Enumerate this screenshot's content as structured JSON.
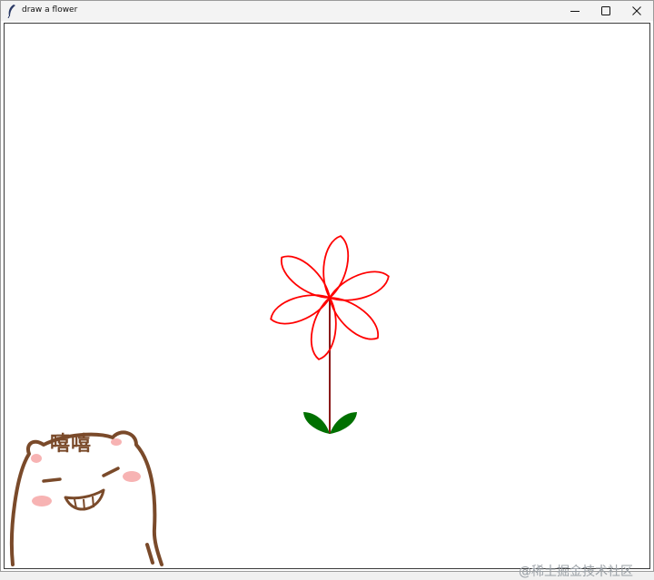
{
  "window": {
    "title": "draw a flower",
    "icon": "feather-icon",
    "controls": {
      "minimize": "minimize-icon",
      "maximize": "maximize-icon",
      "close": "close-icon"
    }
  },
  "canvas": {
    "background": "#ffffff",
    "flower": {
      "petal_color": "#ff0000",
      "stem_color": "#8b1a1a",
      "leaf_color": "#007000",
      "petal_count": 6
    }
  },
  "overlay": {
    "sticker_caption": "嘻嘻",
    "watermark": "@稀土掘金技术社区"
  },
  "colors": {
    "sticker_outline": "#7a4a2a",
    "sticker_blush": "#f7b3b3",
    "watermark": "#9aa0a6"
  }
}
